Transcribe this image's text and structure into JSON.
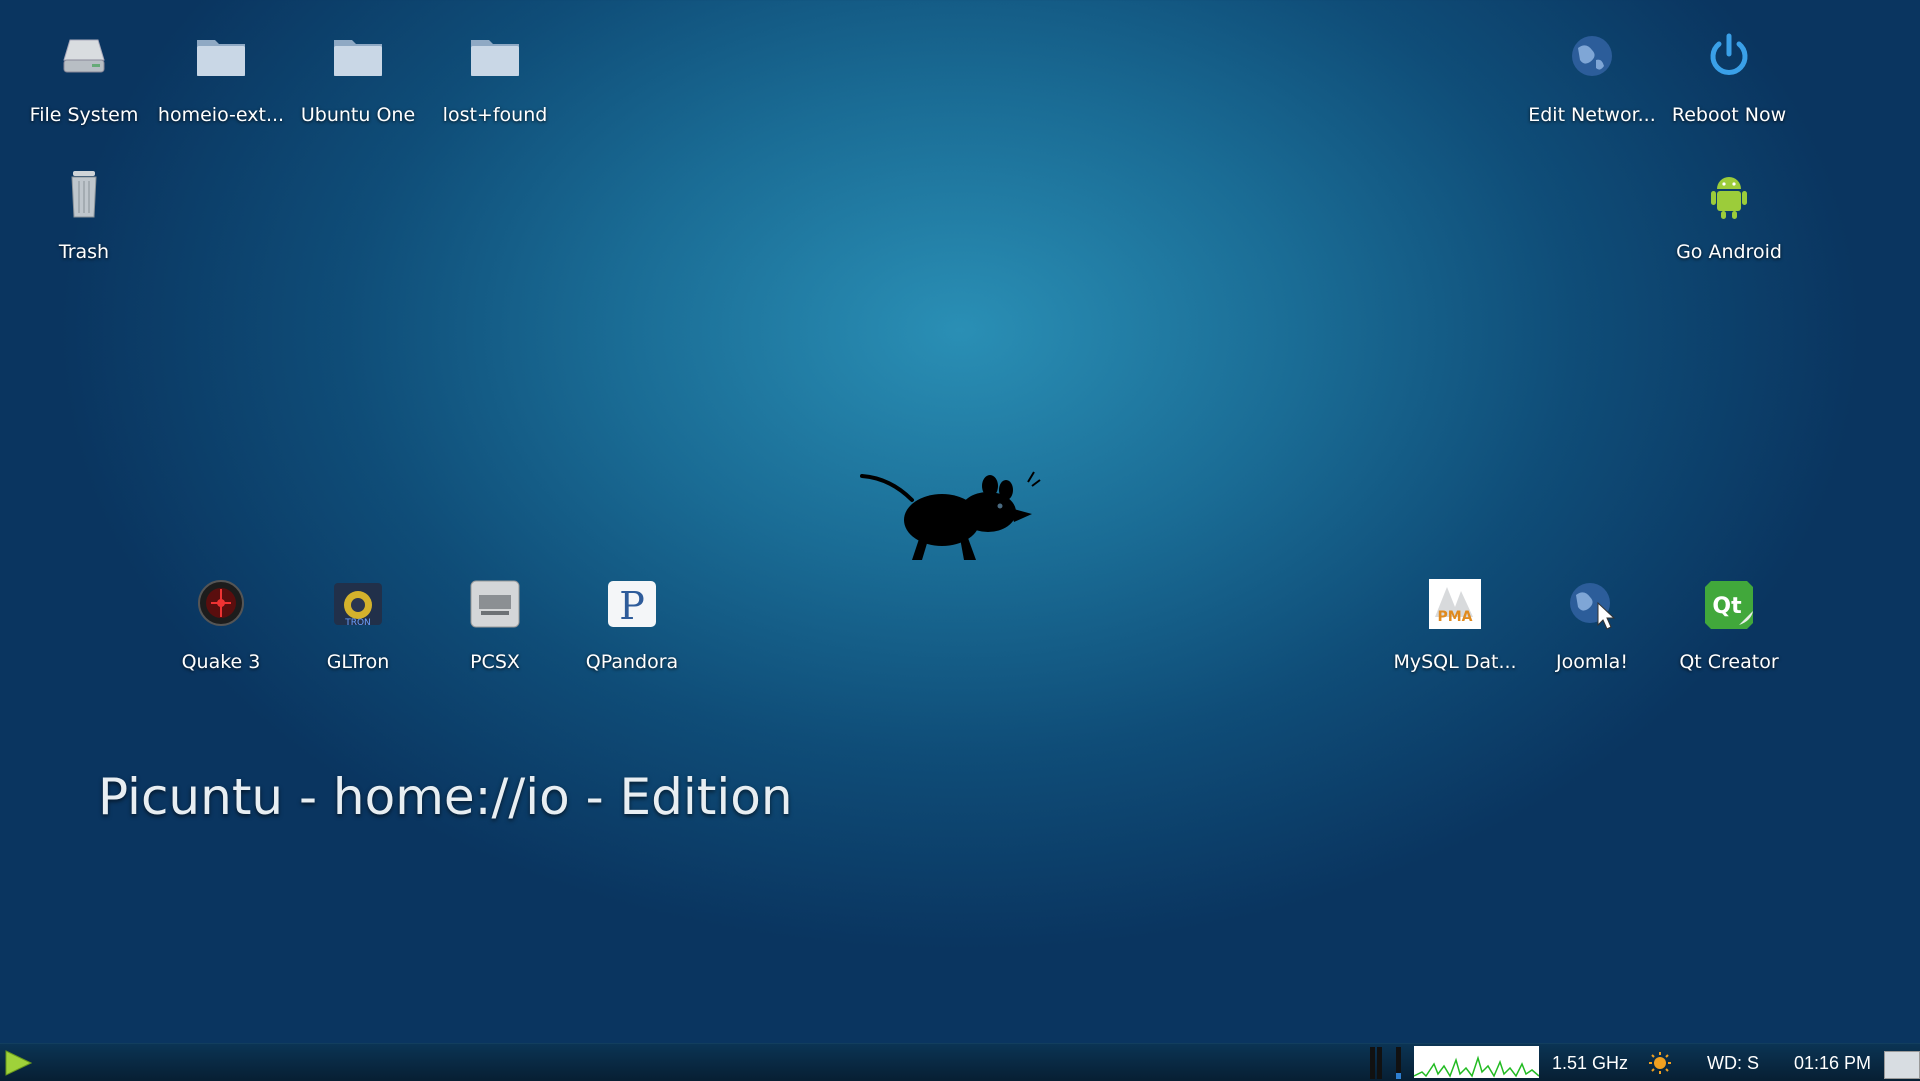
{
  "desktop": {
    "icons_top": [
      {
        "label": "File System",
        "icon": "hard-drive-icon"
      },
      {
        "label": "homeio-ext...",
        "icon": "folder-icon"
      },
      {
        "label": "Ubuntu One",
        "icon": "folder-icon"
      },
      {
        "label": "lost+found",
        "icon": "folder-icon"
      },
      {
        "label": "Trash",
        "icon": "trash-icon"
      }
    ],
    "icons_right": [
      {
        "label": "Edit Networ...",
        "icon": "network-globe-icon"
      },
      {
        "label": "Reboot Now",
        "icon": "power-icon"
      },
      {
        "label": "Go Android",
        "icon": "android-icon"
      }
    ],
    "icons_bottom_left": [
      {
        "label": "Quake 3",
        "icon": "quake-icon"
      },
      {
        "label": "GLTron",
        "icon": "gltron-icon"
      },
      {
        "label": "PCSX",
        "icon": "pcsx-icon"
      },
      {
        "label": "QPandora",
        "icon": "pandora-icon"
      }
    ],
    "icons_bottom_right": [
      {
        "label": "MySQL Dat...",
        "icon": "phpmyadmin-icon"
      },
      {
        "label": "Joomla!",
        "icon": "joomla-globe-icon"
      },
      {
        "label": "Qt Creator",
        "icon": "qt-icon"
      }
    ],
    "edition_text": "Picuntu - home://io - Edition"
  },
  "panel": {
    "cpu_freq": "1.51 GHz",
    "weather_label": "WD: S",
    "clock": "01:16 PM",
    "colors": {
      "panel": "#0b3454",
      "graph_line": "#22bb22",
      "start": "#9fd23a"
    }
  }
}
